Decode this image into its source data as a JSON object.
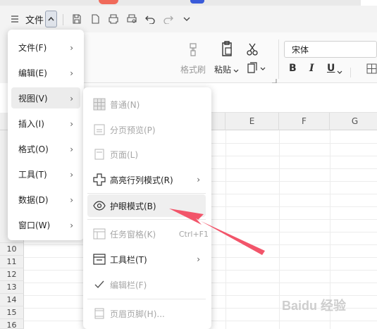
{
  "quick_bar": {
    "file_label": "文件"
  },
  "ribbon": {
    "format_painter": "格式刷",
    "paste": "粘贴",
    "font_name": "宋体"
  },
  "grid": {
    "columns": [
      "E",
      "F",
      "G"
    ],
    "rows": [
      "10",
      "11",
      "12",
      "13",
      "14",
      "15",
      "16"
    ]
  },
  "file_menu": {
    "items": [
      {
        "label": "文件(F)"
      },
      {
        "label": "编辑(E)"
      },
      {
        "label": "视图(V)",
        "active": true
      },
      {
        "label": "插入(I)"
      },
      {
        "label": "格式(O)"
      },
      {
        "label": "工具(T)"
      },
      {
        "label": "数据(D)"
      },
      {
        "label": "窗口(W)"
      }
    ]
  },
  "view_menu": {
    "items": [
      {
        "label": "普通(N)",
        "enabled": false,
        "icon": "grid-icon"
      },
      {
        "label": "分页预览(P)",
        "enabled": false,
        "icon": "page-break-icon"
      },
      {
        "label": "页面(L)",
        "enabled": false,
        "icon": "page-icon"
      },
      {
        "label": "高亮行列模式(R)",
        "enabled": true,
        "icon": "crosshair-icon",
        "submenu": true
      },
      {
        "label": "护眼模式(B)",
        "enabled": true,
        "icon": "eye-icon",
        "highlighted": true
      },
      {
        "label": "任务窗格(K)",
        "enabled": false,
        "icon": "task-pane-icon",
        "shortcut": "Ctrl+F1"
      },
      {
        "label": "工具栏(T)",
        "enabled": true,
        "icon": "toolbar-icon",
        "submenu": true
      },
      {
        "label": "编辑栏(F)",
        "enabled": false,
        "icon": "check-icon"
      },
      {
        "label": "页眉页脚(H)...",
        "enabled": false,
        "icon": "header-footer-icon"
      }
    ]
  },
  "watermark": "Baidu 经验",
  "colors": {
    "arrow": "#f2556a",
    "menu_highlight": "#efefef"
  }
}
